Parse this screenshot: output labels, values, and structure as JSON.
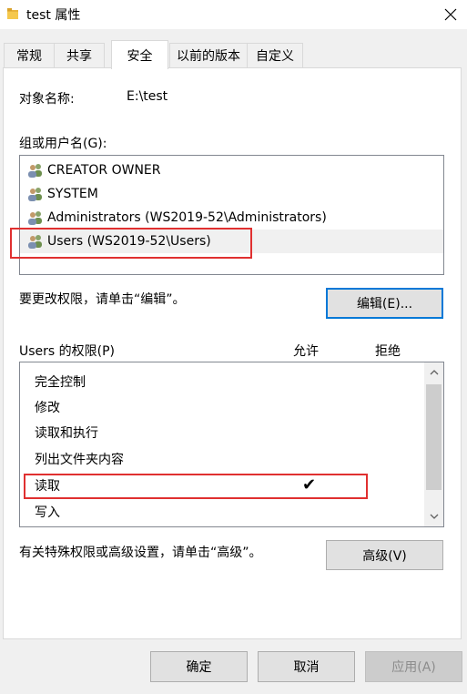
{
  "window": {
    "title": "test 属性"
  },
  "tabs": [
    {
      "label": "常规"
    },
    {
      "label": "共享"
    },
    {
      "label": "安全"
    },
    {
      "label": "以前的版本"
    },
    {
      "label": "自定义"
    }
  ],
  "object": {
    "label": "对象名称:",
    "value": "E:\\test"
  },
  "groups": {
    "label": "组或用户名(G):",
    "items": [
      {
        "name": "CREATOR OWNER"
      },
      {
        "name": "SYSTEM"
      },
      {
        "name": "Administrators (WS2019-52\\Administrators)"
      },
      {
        "name": "Users (WS2019-52\\Users)"
      }
    ]
  },
  "edit": {
    "hint": "要更改权限，请单击“编辑”。",
    "button": "编辑(E)..."
  },
  "permissions": {
    "label": "Users 的权限(P)",
    "allow_header": "允许",
    "deny_header": "拒绝",
    "check_glyph": "✔",
    "rows": [
      {
        "name": "完全控制",
        "allow": false,
        "deny": false
      },
      {
        "name": "修改",
        "allow": false,
        "deny": false
      },
      {
        "name": "读取和执行",
        "allow": false,
        "deny": false
      },
      {
        "name": "列出文件夹内容",
        "allow": false,
        "deny": false
      },
      {
        "name": "读取",
        "allow": true,
        "deny": false
      },
      {
        "name": "写入",
        "allow": false,
        "deny": false
      }
    ]
  },
  "advanced": {
    "hint": "有关特殊权限或高级设置，请单击“高级”。",
    "button": "高级(V)"
  },
  "footer": {
    "ok": "确定",
    "cancel": "取消",
    "apply": "应用(A)"
  },
  "colors": {
    "highlight": "#e03030",
    "selected_row": "#f0f0f0",
    "accent": "#0078d7"
  }
}
